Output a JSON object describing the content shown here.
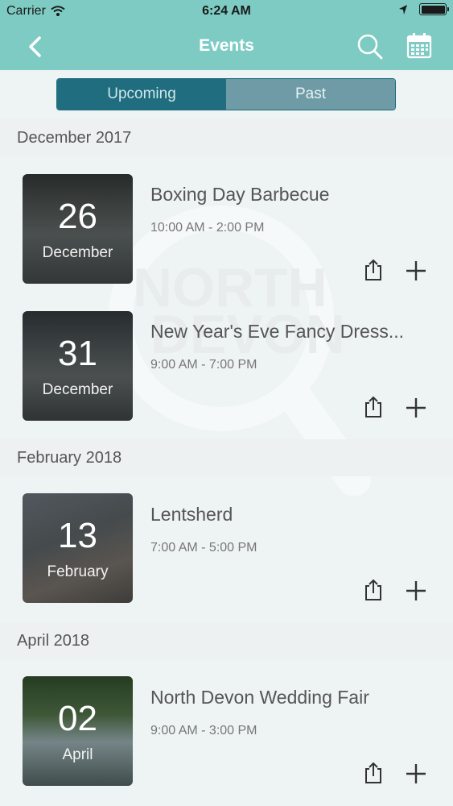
{
  "status_bar": {
    "carrier": "Carrier",
    "time": "6:24 AM"
  },
  "nav": {
    "title": "Events",
    "back_icon": "chevron-left-icon",
    "search_icon": "search-icon",
    "calendar_icon": "calendar-icon"
  },
  "segment": {
    "upcoming": "Upcoming",
    "past": "Past",
    "selected": "Upcoming"
  },
  "colors": {
    "header": "#7ecbc4",
    "segment_active": "#1f6d7e",
    "segment_inactive": "#6f9ba6"
  },
  "sections": [
    {
      "header": "December 2017",
      "events": [
        {
          "day": "26",
          "month": "December",
          "title": "Boxing Day Barbecue",
          "time": "10:00 AM - 2:00 PM"
        },
        {
          "day": "31",
          "month": "December",
          "title": "New Year's Eve Fancy Dress...",
          "time": "9:00 AM - 7:00 PM"
        }
      ]
    },
    {
      "header": "February 2018",
      "events": [
        {
          "day": "13",
          "month": "February",
          "title": "Lentsherd",
          "time": "7:00 AM - 5:00 PM"
        }
      ]
    },
    {
      "header": "April 2018",
      "events": [
        {
          "day": "02",
          "month": "April",
          "title": "North Devon Wedding Fair",
          "time": "9:00 AM - 3:00 PM"
        }
      ]
    }
  ],
  "watermark": {
    "line1": "NORTH",
    "line2": "DEVON"
  }
}
